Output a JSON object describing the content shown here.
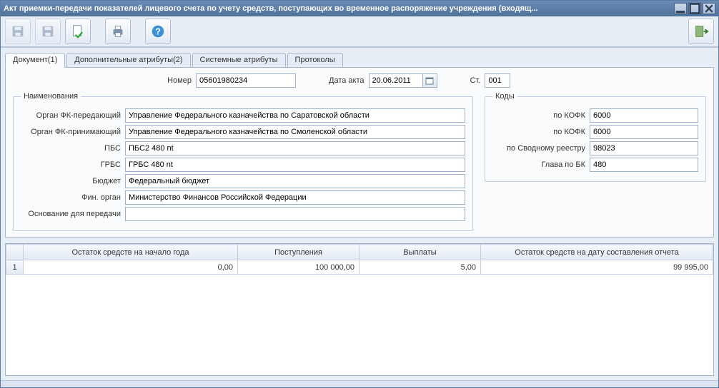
{
  "window": {
    "title": "Акт приемки-передачи показателей лицевого счета по учету средств, поступающих во временное распоряжение учреждения (входящ..."
  },
  "tabs": [
    {
      "label": "Документ(1)"
    },
    {
      "label": "Дополнительные атрибуты(2)"
    },
    {
      "label": "Системные атрибуты"
    },
    {
      "label": "Протоколы"
    }
  ],
  "top": {
    "number_label": "Номер",
    "number_value": "05601980234",
    "date_label": "Дата акта",
    "date_value": "20.06.2011",
    "st_label": "Ст.",
    "st_value": "001"
  },
  "names_legend": "Наименования",
  "codes_legend": "Коды",
  "fields": {
    "org_fk_send_label": "Орган ФК-передающий",
    "org_fk_send_value": "Управление Федерального казначейства по Саратовской области",
    "org_fk_recv_label": "Орган ФК-принимающий",
    "org_fk_recv_value": "Управление Федерального казначейства по Смоленской области",
    "pbs_label": "ПБС",
    "pbs_value": "ПБС2 480 nt",
    "grbs_label": "ГРБС",
    "grbs_value": "ГРБС 480 nt",
    "budget_label": "Бюджет",
    "budget_value": "Федеральный бюджет",
    "finorg_label": "Фин. орган",
    "finorg_value": "Министерство Финансов Российской Федерации",
    "reason_label": "Основание для передачи",
    "reason_value": ""
  },
  "codes": {
    "kofk1_label": "по КОФК",
    "kofk1_value": "6000",
    "kofk2_label": "по КОФК",
    "kofk2_value": "6000",
    "svod_label": "по Сводному реестру",
    "svod_value": "98023",
    "glava_label": "Глава по БК",
    "glava_value": "480"
  },
  "table": {
    "headers": [
      "",
      "Остаток средств на начало года",
      "Поступления",
      "Выплаты",
      "Остаток средств на дату составления отчета"
    ],
    "rows": [
      {
        "n": "1",
        "c1": "0,00",
        "c2": "100 000,00",
        "c3": "5,00",
        "c4": "99 995,00"
      }
    ]
  }
}
